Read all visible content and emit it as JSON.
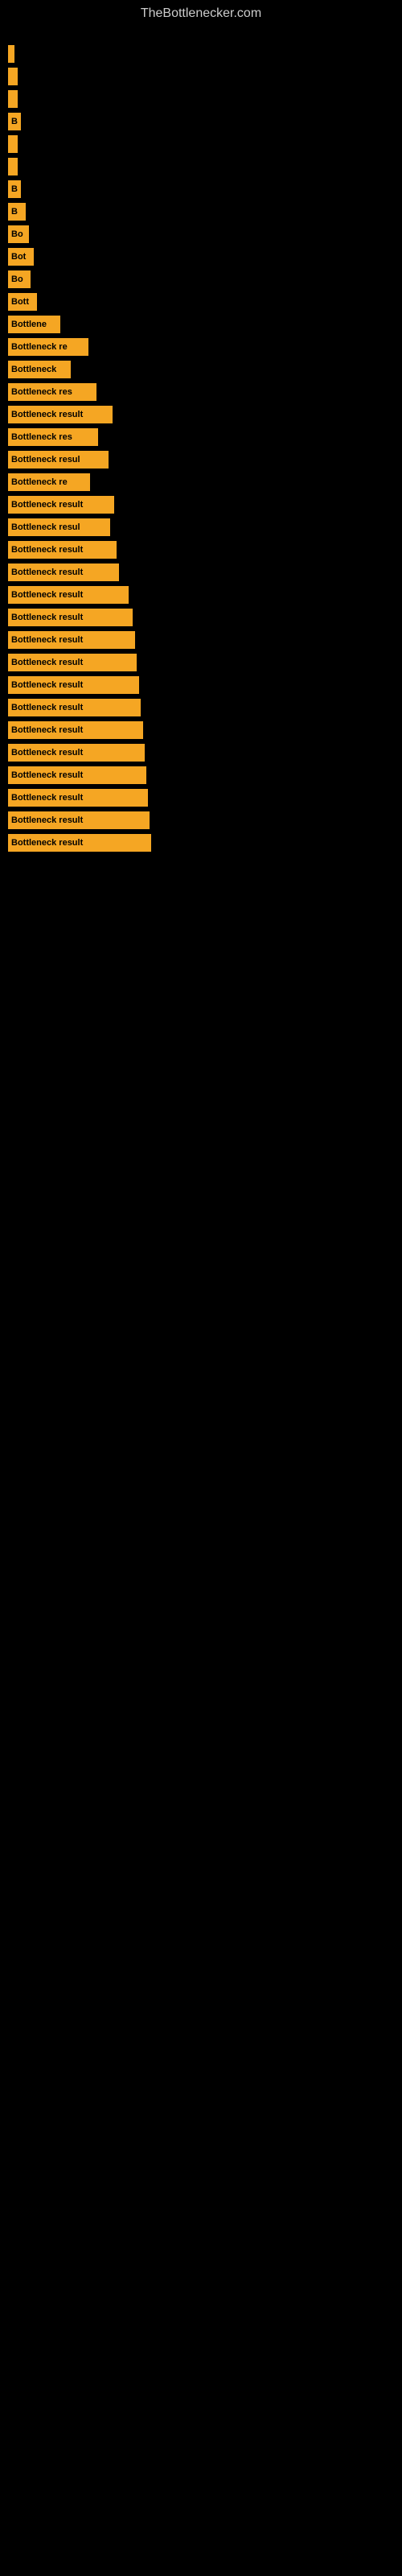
{
  "site": {
    "title": "TheBottlenecker.com"
  },
  "bars": [
    {
      "label": "",
      "width": 8
    },
    {
      "label": "",
      "width": 12
    },
    {
      "label": "",
      "width": 12
    },
    {
      "label": "B",
      "width": 16
    },
    {
      "label": "",
      "width": 12
    },
    {
      "label": "",
      "width": 12
    },
    {
      "label": "B",
      "width": 16
    },
    {
      "label": "B",
      "width": 22
    },
    {
      "label": "Bo",
      "width": 26
    },
    {
      "label": "Bot",
      "width": 32
    },
    {
      "label": "Bo",
      "width": 28
    },
    {
      "label": "Bott",
      "width": 36
    },
    {
      "label": "Bottlene",
      "width": 65
    },
    {
      "label": "Bottleneck re",
      "width": 100
    },
    {
      "label": "Bottleneck",
      "width": 78
    },
    {
      "label": "Bottleneck res",
      "width": 110
    },
    {
      "label": "Bottleneck result",
      "width": 130
    },
    {
      "label": "Bottleneck res",
      "width": 112
    },
    {
      "label": "Bottleneck resul",
      "width": 125
    },
    {
      "label": "Bottleneck re",
      "width": 102
    },
    {
      "label": "Bottleneck result",
      "width": 132
    },
    {
      "label": "Bottleneck resul",
      "width": 127
    },
    {
      "label": "Bottleneck result",
      "width": 135
    },
    {
      "label": "Bottleneck result",
      "width": 138
    },
    {
      "label": "Bottleneck result",
      "width": 150
    },
    {
      "label": "Bottleneck result",
      "width": 155
    },
    {
      "label": "Bottleneck result",
      "width": 158
    },
    {
      "label": "Bottleneck result",
      "width": 160
    },
    {
      "label": "Bottleneck result",
      "width": 163
    },
    {
      "label": "Bottleneck result",
      "width": 165
    },
    {
      "label": "Bottleneck result",
      "width": 168
    },
    {
      "label": "Bottleneck result",
      "width": 170
    },
    {
      "label": "Bottleneck result",
      "width": 172
    },
    {
      "label": "Bottleneck result",
      "width": 174
    },
    {
      "label": "Bottleneck result",
      "width": 176
    },
    {
      "label": "Bottleneck result",
      "width": 178
    }
  ]
}
